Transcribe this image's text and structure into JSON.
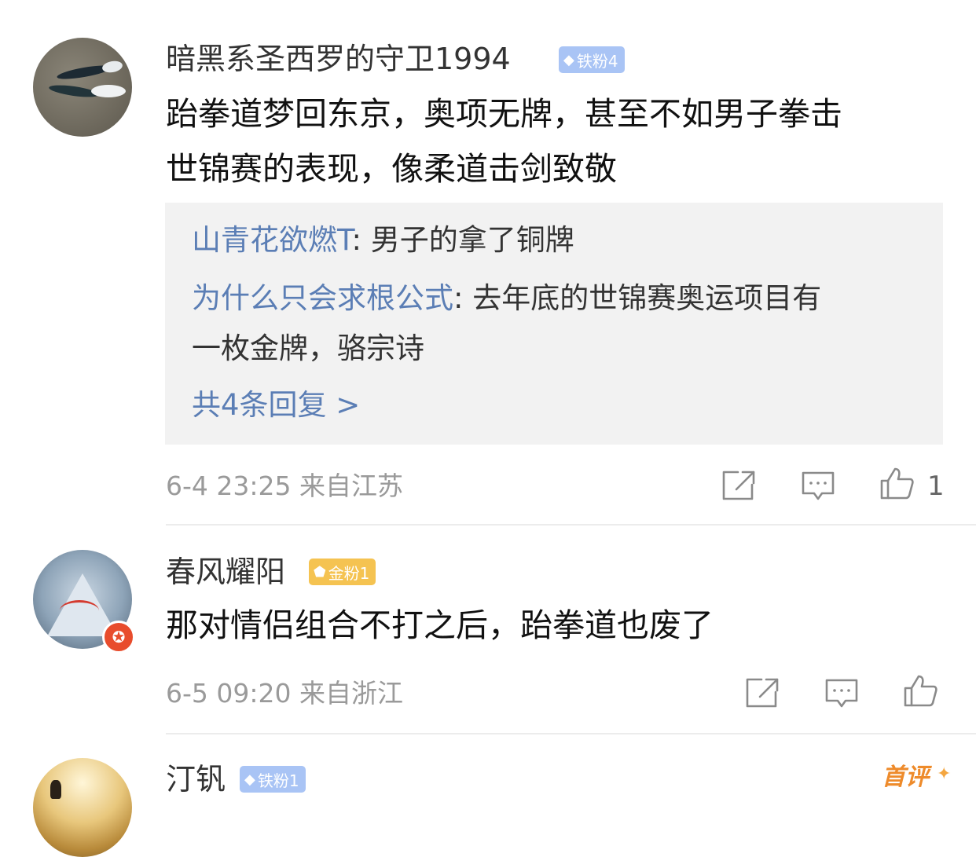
{
  "comments": [
    {
      "username": "暗黑系圣西罗的守卫1994",
      "fan_badge": "铁粉4",
      "text_line1": "跆拳道梦回东京，奥项无牌，甚至不如男子拳击",
      "text_line2": "世锦赛的表现，像柔道击剑致敬",
      "replies": [
        {
          "name": "山青花欲燃T",
          "text": ": 男子的拿了铜牌"
        },
        {
          "name": "为什么只会求根公式",
          "text": ": 去年底的世锦赛奥运项目有",
          "text2": "一枚金牌，骆宗诗"
        }
      ],
      "more_replies": "共4条回复 >",
      "time": "6-4 23:25",
      "location": "来自江苏",
      "like_count": "1"
    },
    {
      "username": "春风耀阳",
      "fan_badge": "金粉1",
      "text_line1": "那对情侣组合不打之后，跆拳道也废了",
      "time": "6-5 09:20",
      "location": "来自浙江"
    },
    {
      "username": "汀钒",
      "fan_badge": "铁粉1",
      "first_tag": "首评"
    }
  ],
  "icons": {
    "share": "share-icon",
    "comment": "comment-icon",
    "like": "thumbs-up-icon",
    "gem": "diamond-icon",
    "vip": "star-icon"
  },
  "colors": {
    "link_blue": "#5b7eb5",
    "iron_badge": "#a9c4f5",
    "gold_badge": "#f5c351",
    "meta_gray": "#9a9a9a",
    "first_tag": "#ee8b2b"
  }
}
